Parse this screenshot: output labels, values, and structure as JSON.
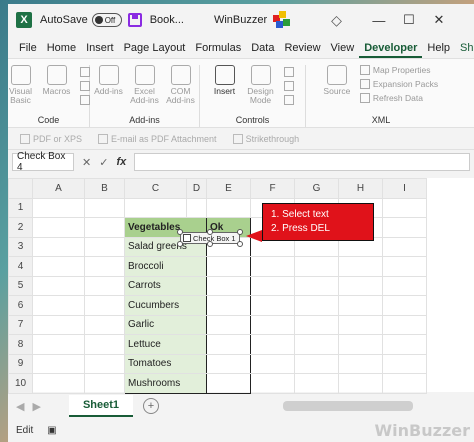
{
  "titlebar": {
    "autosave_label": "AutoSave",
    "autosave_state": "Off",
    "book_name": "Book...",
    "center_title": "WinBuzzer",
    "buttons": [
      "minimize",
      "maximize",
      "close"
    ]
  },
  "tabs": [
    {
      "label": "File"
    },
    {
      "label": "Home"
    },
    {
      "label": "Insert"
    },
    {
      "label": "Page Layout"
    },
    {
      "label": "Formulas"
    },
    {
      "label": "Data"
    },
    {
      "label": "Review"
    },
    {
      "label": "View"
    },
    {
      "label": "Developer"
    },
    {
      "label": "Help"
    },
    {
      "label": "Shape Format"
    }
  ],
  "ribbon": {
    "code": {
      "label": "Code",
      "buttons": [
        "Visual Basic",
        "Macros"
      ]
    },
    "addins": {
      "label": "Add-ins",
      "buttons": [
        "Add-ins",
        "Excel Add-ins",
        "COM Add-ins"
      ]
    },
    "controls": {
      "label": "Controls",
      "buttons": [
        "Insert",
        "Design Mode"
      ]
    },
    "xml": {
      "label": "XML",
      "buttons": [
        "Source"
      ],
      "items": [
        "Map Properties",
        "Expansion Packs",
        "Refresh Data"
      ]
    }
  },
  "toolbar2": {
    "items": [
      "PDF or XPS",
      "E-mail as PDF Attachment",
      "Strikethrough"
    ]
  },
  "formula": {
    "namebox": "Check Box 4",
    "fx": "fx",
    "cancel": "✕",
    "enter": "✓"
  },
  "grid": {
    "columns": [
      "A",
      "B",
      "C",
      "D",
      "E",
      "F",
      "G",
      "H",
      "I"
    ],
    "rows": [
      "1",
      "2",
      "3",
      "4",
      "5",
      "6",
      "7",
      "8",
      "9",
      "10"
    ],
    "table_header": {
      "vegetables": "Vegetables",
      "ok": "Ok"
    },
    "vegetables": [
      "Salad greens",
      "Broccoli",
      "Carrots",
      "Cucumbers",
      "Garlic",
      "Lettuce",
      "Tomatoes",
      "Mushrooms"
    ],
    "checkbox_label": "Check Box 1"
  },
  "callout": {
    "line1": "1. Select text",
    "line2": "2. Press DEL"
  },
  "sheet_tabs": {
    "active": "Sheet1",
    "add": "+"
  },
  "statusbar": {
    "mode": "Edit"
  },
  "watermark": "WinBuzzer"
}
